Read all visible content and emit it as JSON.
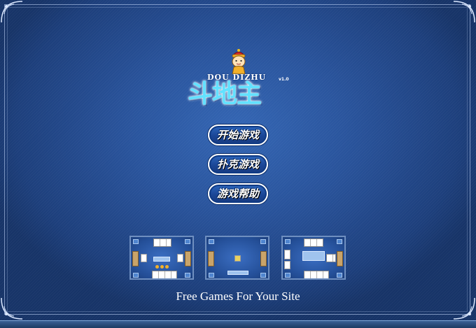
{
  "logo": {
    "english_name": "DOU DIZHU",
    "version": "v1.0",
    "chinese_name": "斗地主"
  },
  "menu": {
    "start_game": "开始游戏",
    "poker_game": "扑克游戏",
    "game_help": "游戏帮助"
  },
  "footer": {
    "text": "Free Games For Your Site"
  },
  "colors": {
    "background": "#2a559e",
    "title_text": "#62e1ff",
    "button_fill": "#1b4696",
    "button_border": "#ffffff"
  },
  "icons": [
    "mascot-icon",
    "corner-ornament-icon"
  ]
}
